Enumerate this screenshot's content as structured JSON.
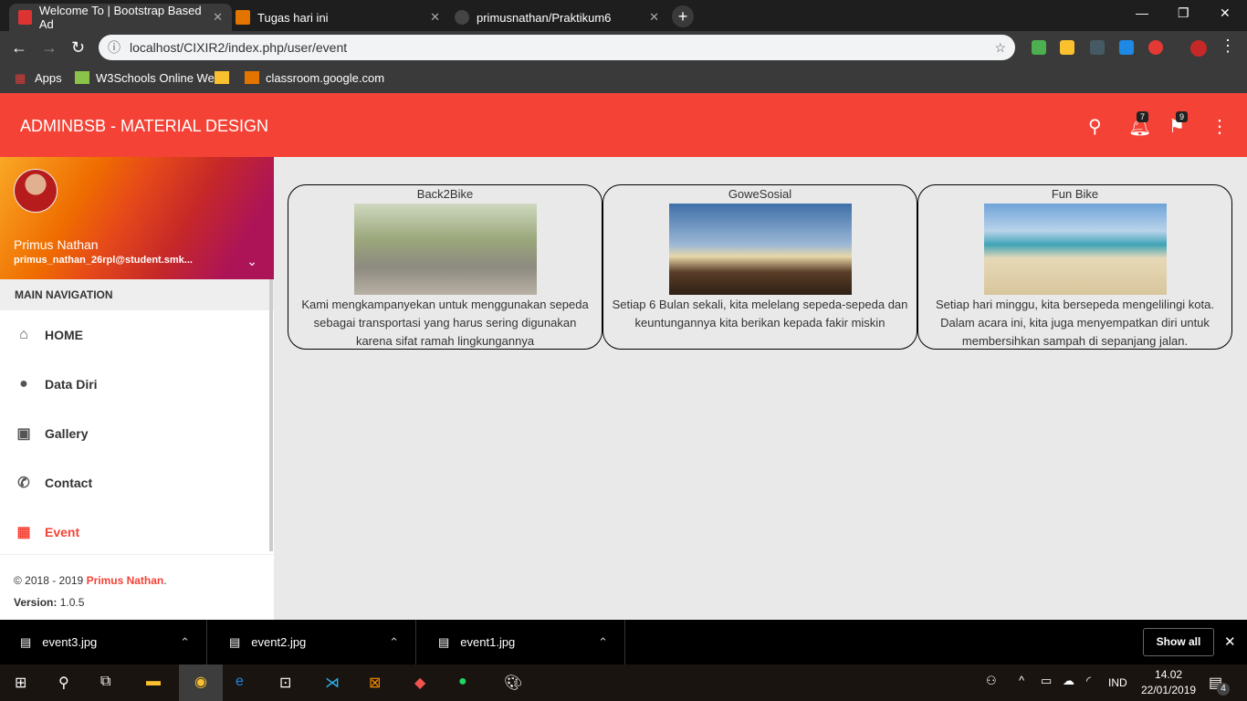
{
  "browser": {
    "tabs": [
      {
        "label": "Welcome To | Bootstrap Based Ad",
        "icon": "angular-icon",
        "color": "#dd3333"
      },
      {
        "label": "Tugas hari ini",
        "icon": "classroom-icon",
        "color": "#e37400"
      },
      {
        "label": "primusnathan/Praktikum6",
        "icon": "github-icon",
        "color": "#444444"
      }
    ],
    "url": "localhost/CIXIR2/index.php/user/event",
    "bookmarks": [
      "Apps",
      "W3Schools Online We",
      "classroom.google.com"
    ]
  },
  "app": {
    "title": "ADMINBSB - MATERIAL DESIGN",
    "notifications": "7",
    "flags": "9",
    "accent": "#f44336"
  },
  "user": {
    "name": "Primus Nathan",
    "email": "primus_nathan_26rpl@student.smk..."
  },
  "nav": {
    "header": "MAIN NAVIGATION",
    "items": [
      {
        "label": "HOME",
        "icon": "⌂"
      },
      {
        "label": "Data Diri",
        "icon": "👤"
      },
      {
        "label": "Gallery",
        "icon": "▣"
      },
      {
        "label": "Contact",
        "icon": "✆"
      },
      {
        "label": "Event",
        "icon": "▦"
      }
    ]
  },
  "footer": {
    "copyright": "© 2018 - 2019 ",
    "author": "Primus Nathan",
    "dot": ".",
    "version_label": "Version:",
    "version": " 1.0.5"
  },
  "events": [
    {
      "title": "Back2Bike",
      "desc": "Kami mengkampanyekan untuk menggunakan sepeda sebagai transportasi yang harus sering digunakan karena sifat ramah lingkungannya"
    },
    {
      "title": "GoweSosial",
      "desc": "Setiap 6 Bulan sekali, kita melelang sepeda-sepeda dan keuntungannya kita berikan kepada fakir miskin"
    },
    {
      "title": "Fun Bike",
      "desc": "Setiap hari minggu, kita bersepeda mengelilingi kota. Dalam acara ini, kita juga menyempatkan diri untuk membersihkan sampah di sepanjang jalan."
    }
  ],
  "downloads": {
    "files": [
      "event3.jpg",
      "event2.jpg",
      "event1.jpg"
    ],
    "show_all": "Show all"
  },
  "taskbar": {
    "lang": "IND",
    "time": "14.02",
    "date": "22/01/2019",
    "notif_count": "4"
  }
}
